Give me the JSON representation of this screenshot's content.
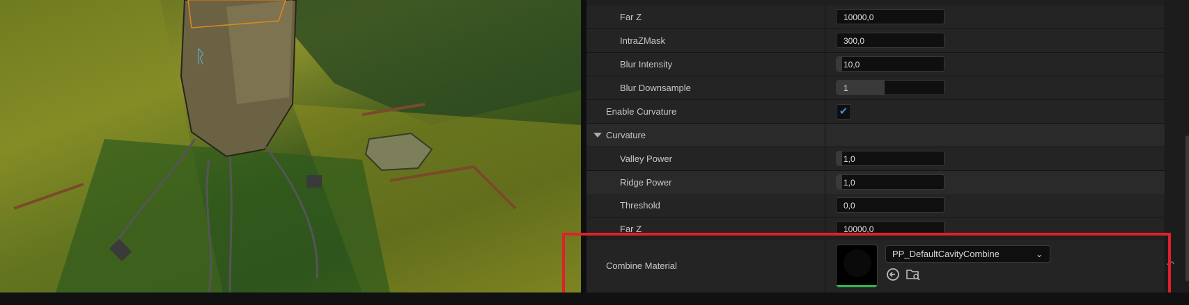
{
  "details": {
    "rows": [
      {
        "label": "Far Z",
        "value": "10000,0",
        "fill": 0
      },
      {
        "label": "IntraZMask",
        "value": "300,0",
        "fill": 0
      },
      {
        "label": "Blur Intensity",
        "value": "10,0",
        "fill": 0.05
      },
      {
        "label": "Blur Downsample",
        "value": "1",
        "fill": 0.45
      },
      {
        "label": "Enable Curvature",
        "checked": true
      },
      {
        "label": "Curvature",
        "section": true
      },
      {
        "label": "Valley Power",
        "value": "1,0",
        "fill": 0.05
      },
      {
        "label": "Ridge Power",
        "value": "1,0",
        "fill": 0.05
      },
      {
        "label": "Threshold",
        "value": "0,0",
        "fill": 0
      },
      {
        "label": "Far Z",
        "value": "10000,0",
        "fill": 0
      }
    ],
    "combine": {
      "label": "Combine Material",
      "asset": "PP_DefaultCavityCombine"
    }
  },
  "icons": {
    "checkbox": "checkmark-icon",
    "expand": "triangle-down-icon",
    "dropdown": "chevron-down-icon",
    "use_selected": "arrow-left-circle-icon",
    "browse": "folder-search-icon",
    "reset": "reset-arrow-icon"
  },
  "colors": {
    "highlight": "#e0202b",
    "check": "#3d8fe0",
    "thumb_bar": "#2bb84a"
  }
}
